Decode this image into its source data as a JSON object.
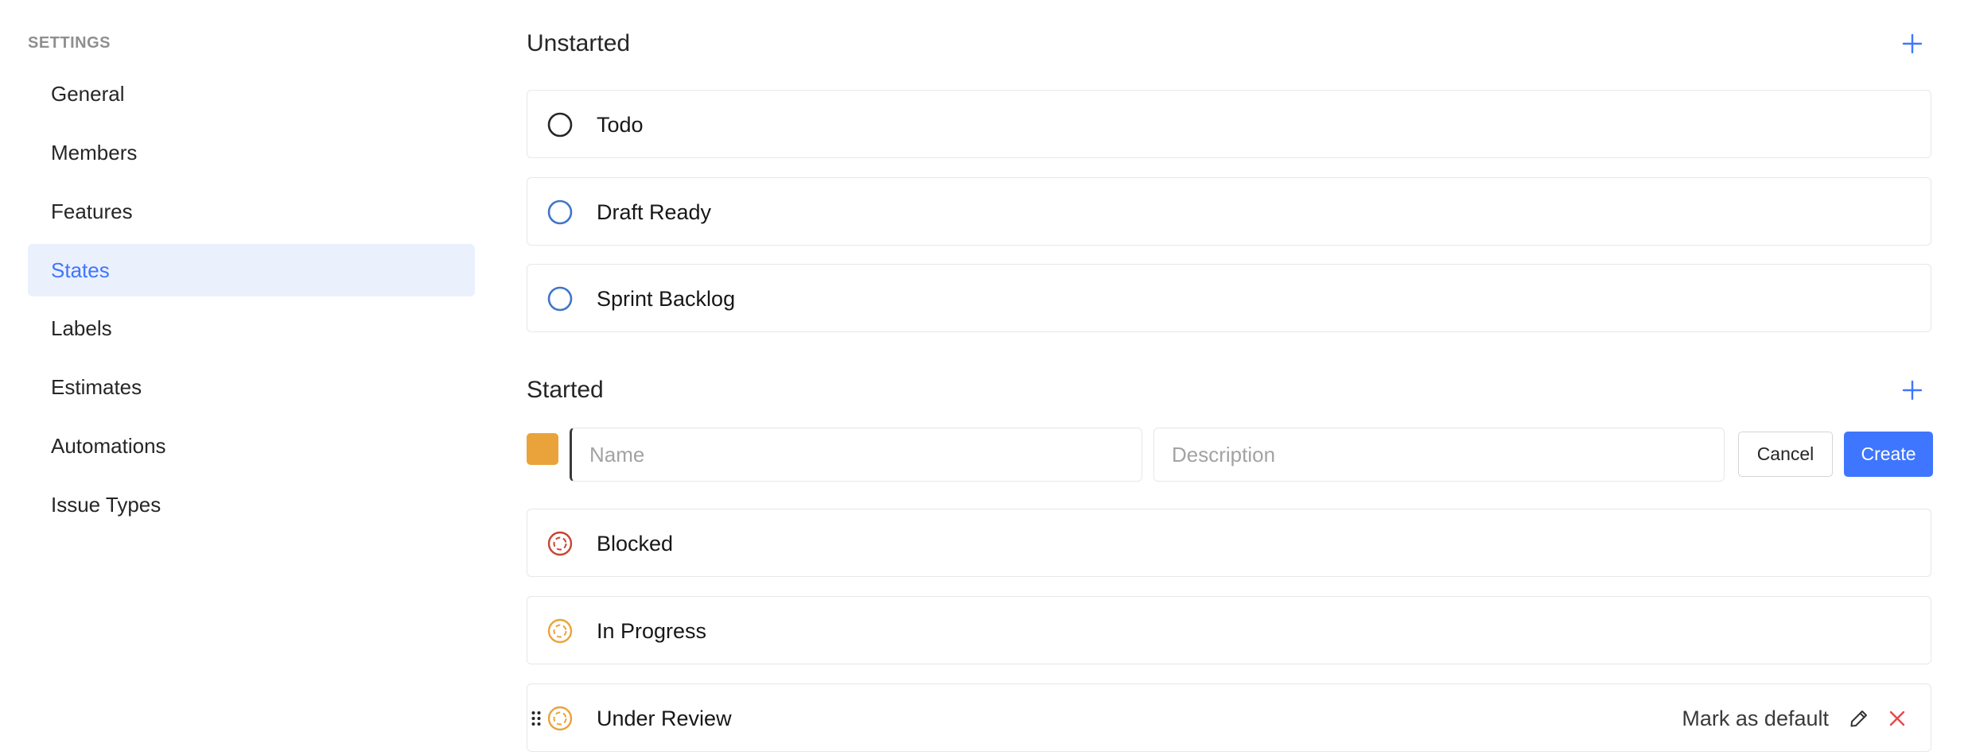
{
  "sidebar": {
    "heading": "SETTINGS",
    "items": [
      {
        "label": "General"
      },
      {
        "label": "Members"
      },
      {
        "label": "Features"
      },
      {
        "label": "States",
        "active": true
      },
      {
        "label": "Labels"
      },
      {
        "label": "Estimates"
      },
      {
        "label": "Automations"
      },
      {
        "label": "Issue Types"
      }
    ]
  },
  "groups": {
    "unstarted": {
      "title": "Unstarted",
      "add_icon": "plus-icon",
      "states": [
        {
          "name": "Todo",
          "icon": "circle-outline-icon",
          "color": "#262626"
        },
        {
          "name": "Draft Ready",
          "icon": "circle-outline-icon",
          "color": "#3f76c8"
        },
        {
          "name": "Sprint Backlog",
          "icon": "circle-outline-icon",
          "color": "#3f76c8"
        }
      ]
    },
    "started": {
      "title": "Started",
      "add_icon": "plus-icon",
      "states": [
        {
          "name": "Blocked",
          "icon": "dashed-circle-icon",
          "color": "#c84432"
        },
        {
          "name": "In Progress",
          "icon": "dashed-circle-icon",
          "color": "#eaa33b"
        },
        {
          "name": "Under Review",
          "icon": "dashed-circle-icon",
          "color": "#eaa33b"
        }
      ]
    }
  },
  "new_state_form": {
    "color": "#eaa33b",
    "name_placeholder": "Name",
    "name_value": "",
    "description_placeholder": "Description",
    "description_value": "",
    "cancel_label": "Cancel",
    "create_label": "Create"
  },
  "hover_actions": {
    "mark_default_label": "Mark as default",
    "edit_icon": "pencil-icon",
    "delete_icon": "close-icon"
  },
  "colors": {
    "accent": "#3f76ff",
    "active_bg": "#ebf0fd",
    "delete": "#e5484d"
  }
}
